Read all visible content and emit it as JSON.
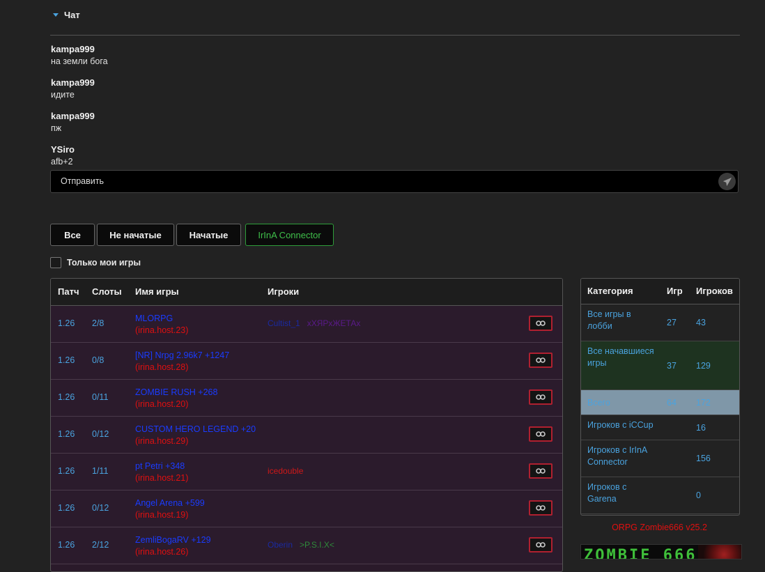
{
  "chat": {
    "title": "Чат",
    "messages": [
      {
        "author": "kampa999",
        "text": "на земли бога"
      },
      {
        "author": "kampa999",
        "text": "идите"
      },
      {
        "author": "kampa999",
        "text": "пж"
      },
      {
        "author": "YSiro",
        "text": "afb+2"
      }
    ],
    "send_placeholder": "Отправить",
    "send_icon": "paper-plane-icon"
  },
  "filters": {
    "all": "Все",
    "not_started": "Не начатые",
    "started": "Начатые",
    "irina": "IrInA Connector",
    "only_mine": "Только мои игры"
  },
  "games_table": {
    "headers": {
      "patch": "Патч",
      "slots": "Слоты",
      "name": "Имя игры",
      "players": "Игроки"
    },
    "rows": [
      {
        "patch": "1.26",
        "slots": "2/8",
        "name": "MLORPG",
        "host": "(irina.host.23)",
        "players": [
          {
            "text": "Cultist_1",
            "color": "#1a2aa0"
          },
          {
            "text": "хХЯРхЖЕТАх",
            "color": "#5a1a8a"
          }
        ]
      },
      {
        "patch": "1.26",
        "slots": "0/8",
        "name": "[NR] Nrpg 2.96k7 +1247",
        "host": "(irina.host.28)",
        "players": []
      },
      {
        "patch": "1.26",
        "slots": "0/11",
        "name": "ZOMBIE RUSH +268",
        "host": "(irina.host.20)",
        "players": []
      },
      {
        "patch": "1.26",
        "slots": "0/12",
        "name": "CUSTOM HERO LEGEND +20",
        "host": "(irina.host.29)",
        "players": []
      },
      {
        "patch": "1.26",
        "slots": "1/11",
        "name": "pt Petri +348",
        "host": "(irina.host.21)",
        "players": [
          {
            "text": "icedouble",
            "color": "#d01818"
          }
        ]
      },
      {
        "patch": "1.26",
        "slots": "0/12",
        "name": "Angel Arena +599",
        "host": "(irina.host.19)",
        "players": []
      },
      {
        "patch": "1.26",
        "slots": "2/12",
        "name": "ZemliBogaRV +129",
        "host": "(irina.host.26)",
        "players": [
          {
            "text": "Oberin",
            "color": "#1a2aa0"
          },
          {
            "text": ">P.S.I.X<",
            "color": "#2e8a3a"
          }
        ]
      }
    ],
    "join_icon": "link-icon"
  },
  "stats_table": {
    "headers": {
      "category": "Категория",
      "games": "Игр",
      "players": "Игроков"
    },
    "rows": [
      {
        "category": "Все игры в лобби",
        "games": "27",
        "players": "43",
        "bg": "#222222"
      },
      {
        "category": "Все начавшиеся игры",
        "games": "37",
        "players": "129",
        "bg": "#1e3320"
      },
      {
        "category": "Всего",
        "games": "64",
        "players": "172",
        "bg": "#7f97a8"
      },
      {
        "category": "Игроков с iCCup",
        "games": "",
        "players": "16",
        "bg": "#222222"
      },
      {
        "category": "Игроков с IrInA Connector",
        "games": "",
        "players": "156",
        "bg": "#222222"
      },
      {
        "category": "Игроков с Garena",
        "games": "",
        "players": "0",
        "bg": "#222222"
      }
    ]
  },
  "footer": {
    "version": "ORPG Zombie666 v25.2",
    "banner_text": "ZOMBIE 666"
  }
}
